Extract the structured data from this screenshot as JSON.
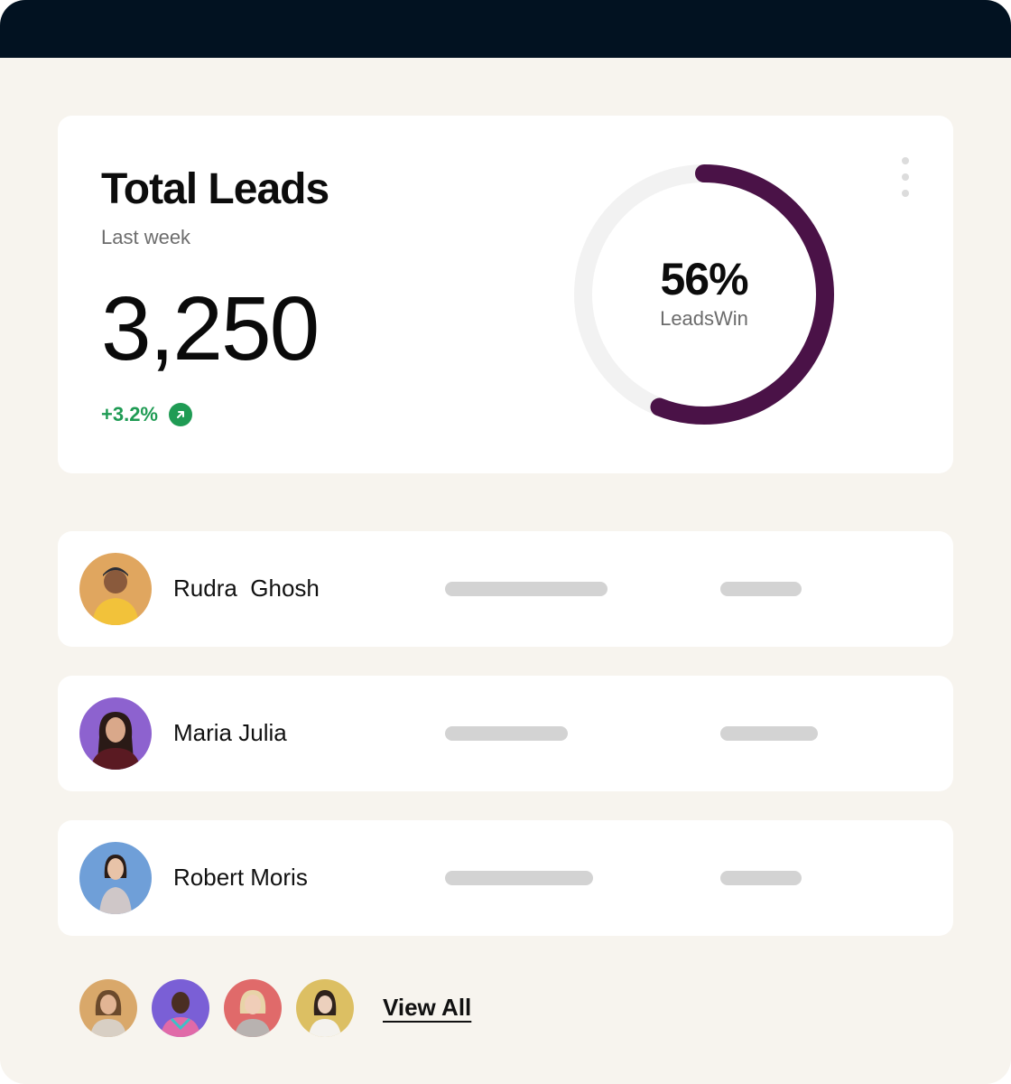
{
  "summary": {
    "title": "Total Leads",
    "period": "Last week",
    "total": "3,250",
    "change": "+3.2%",
    "trend_icon": "arrow-up-right-icon",
    "menu_icon": "more-vertical-icon"
  },
  "donut": {
    "value_label": "56%",
    "caption": "LeadsWin",
    "fraction": 0.56,
    "color": "#4a1247",
    "track_color": "#f2f2f2"
  },
  "leads": [
    {
      "name": "Rudra  Ghosh",
      "avatar_bg": "#e0a65f",
      "placeholder_bars": 2
    },
    {
      "name": "Maria Julia",
      "avatar_bg": "#8d62cf",
      "placeholder_bars": 2
    },
    {
      "name": "Robert Moris",
      "avatar_bg": "#6f9fd8",
      "placeholder_bars": 2
    }
  ],
  "footer": {
    "view_all": "View All",
    "avatar_colors": [
      "#d9a86a",
      "#7a5fd6",
      "#e06a6a",
      "#dcbf63"
    ]
  },
  "colors": {
    "topbar": "#021221",
    "background": "#f7f4ee",
    "positive": "#1f9b54"
  }
}
